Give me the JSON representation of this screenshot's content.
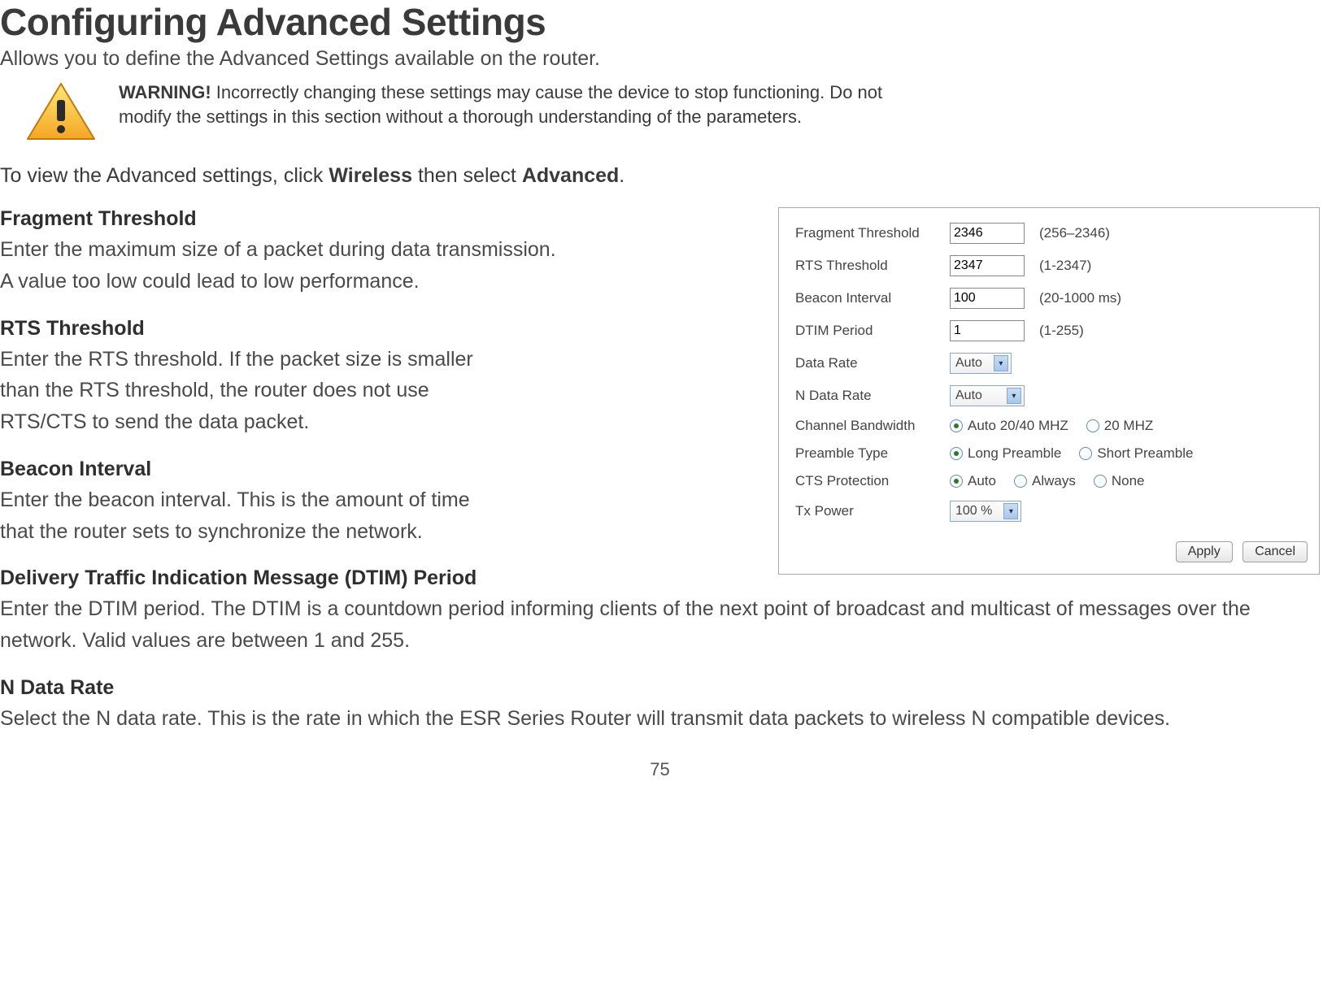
{
  "title": "Configuring Advanced Settings",
  "subtitle": "Allows you to define the Advanced Settings available on the router.",
  "warning": {
    "label": "WARNING!",
    "text": " Incorrectly changing these settings may cause the device to stop functioning. Do not modify the settings in this section without a thorough understanding of the parameters."
  },
  "nav": {
    "prefix": "To view the Advanced settings, click ",
    "link1": "Wireless",
    "mid": " then select ",
    "link2": "Advanced",
    "suffix": "."
  },
  "form": {
    "fragment": {
      "label": "Fragment Threshold",
      "value": "2346",
      "range": "(256–2346)"
    },
    "rts": {
      "label": "RTS Threshold",
      "value": "2347",
      "range": "(1-2347)"
    },
    "beacon": {
      "label": "Beacon Interval",
      "value": "100",
      "range": "(20-1000 ms)"
    },
    "dtim": {
      "label": "DTIM Period",
      "value": "1",
      "range": "(1-255)"
    },
    "dataRate": {
      "label": "Data Rate",
      "value": "Auto"
    },
    "nDataRate": {
      "label": "N Data Rate",
      "value": "Auto"
    },
    "channelBw": {
      "label": "Channel Bandwidth",
      "options": {
        "auto": "Auto 20/40 MHZ",
        "twenty": "20 MHZ"
      }
    },
    "preamble": {
      "label": "Preamble Type",
      "options": {
        "long": "Long Preamble",
        "short": "Short Preamble"
      }
    },
    "cts": {
      "label": "CTS Protection",
      "options": {
        "auto": "Auto",
        "always": "Always",
        "none": "None"
      }
    },
    "txpower": {
      "label": "Tx Power",
      "value": "100 %"
    },
    "buttons": {
      "apply": "Apply",
      "cancel": "Cancel"
    }
  },
  "sections": {
    "fragment": {
      "head": "Fragment Threshold",
      "body1": "Enter the maximum size of a packet during data transmission.",
      "body2": "A value too low could lead to low performance."
    },
    "rts": {
      "head": "RTS Threshold",
      "body": "Enter the RTS threshold. If the packet size is smaller than the RTS threshold, the router does not use RTS/CTS to send the data packet."
    },
    "beacon": {
      "head": "Beacon Interval",
      "body": "Enter the beacon interval. This is the amount of time that the router sets to synchronize the network."
    },
    "dtim": {
      "head": "Delivery Traffic Indication Message (DTIM) Period",
      "body": "Enter the DTIM period. The DTIM is a countdown period informing clients of the next point of broadcast and multicast of messages over the network. Valid values are between 1 and 255."
    },
    "ndata": {
      "head": "N Data Rate",
      "body": "Select the N data rate. This is the rate in which the ESR Series Router will transmit data packets to wireless N compatible devices."
    }
  },
  "pageNumber": "75"
}
